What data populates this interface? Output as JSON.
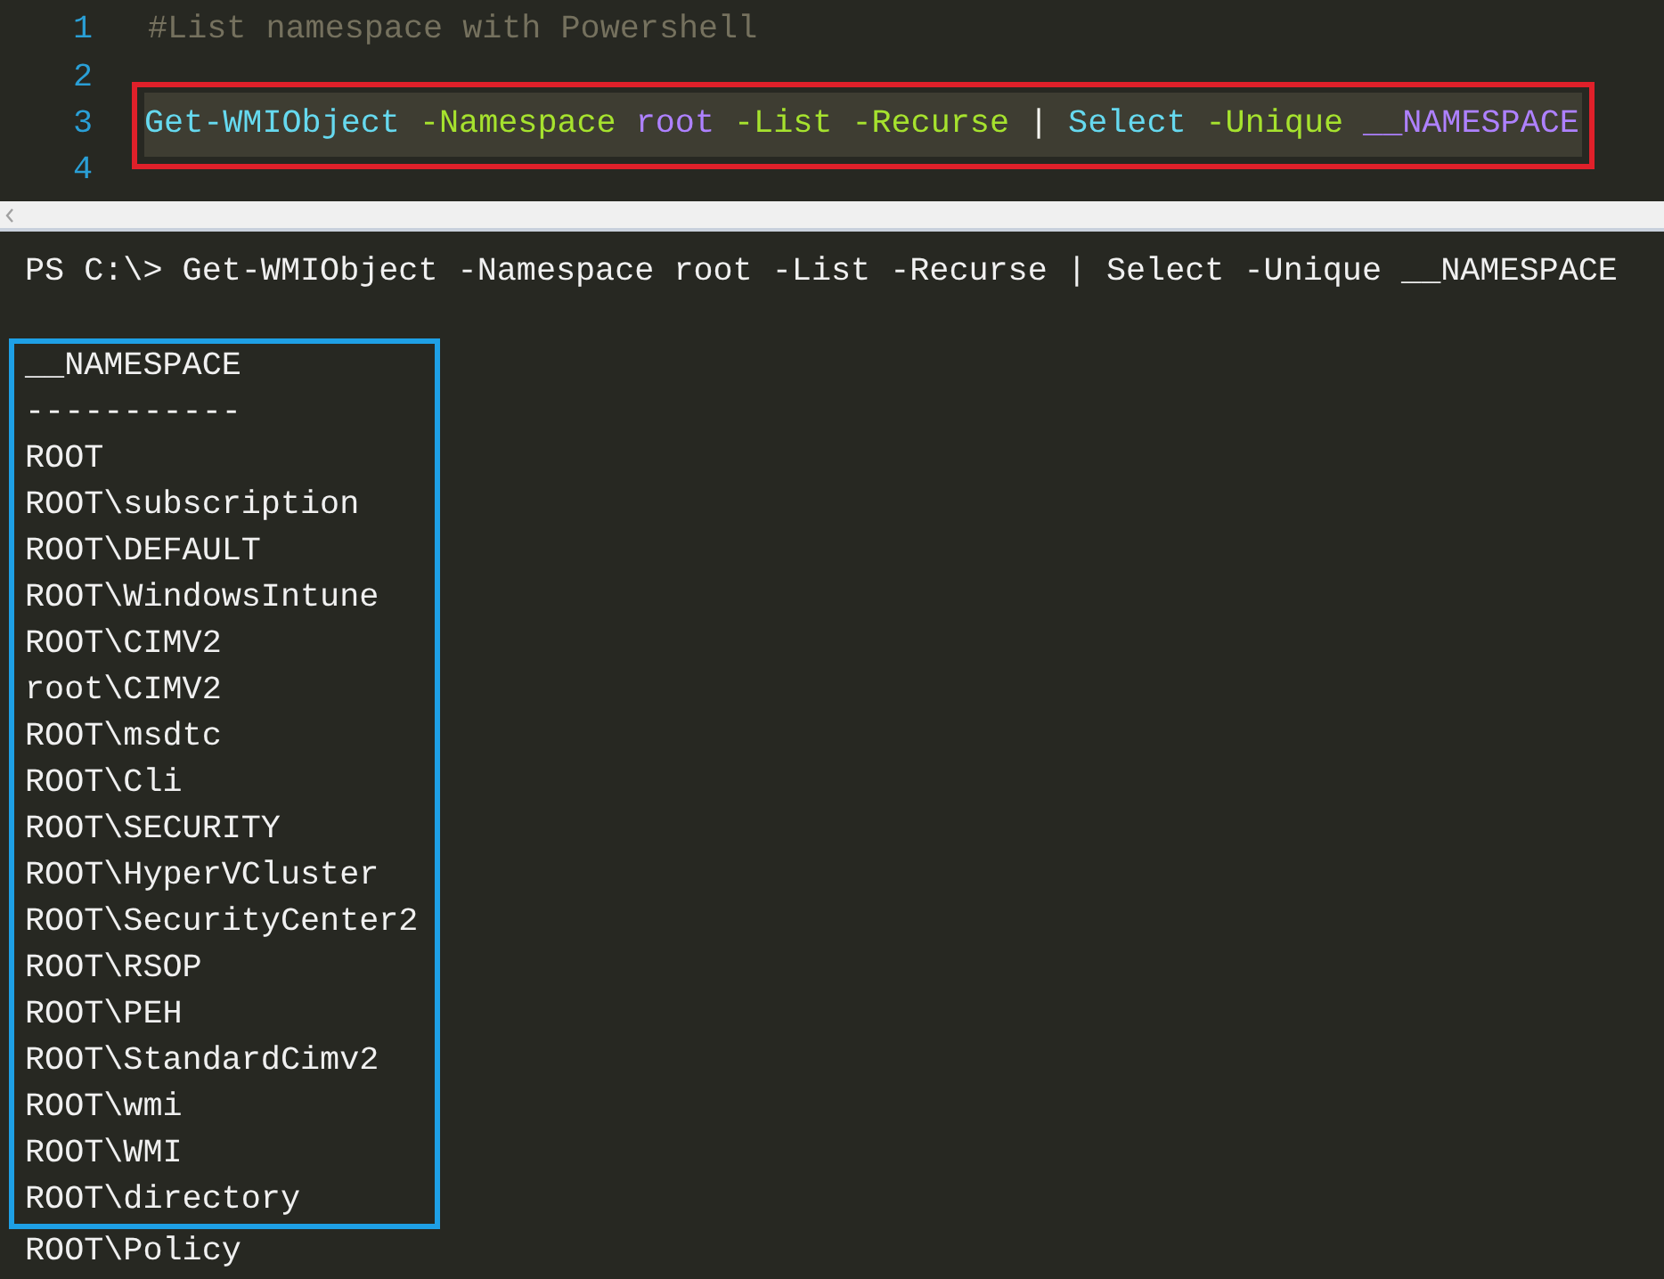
{
  "editor": {
    "lines": [
      {
        "number": "1",
        "kind": "plain",
        "tokens": [
          {
            "kind": "comment",
            "text": "#List namespace with Powershell"
          }
        ]
      },
      {
        "number": "2",
        "kind": "plain"
      },
      {
        "number": "3",
        "kind": "boxed",
        "tokens": [
          {
            "kind": "cmdlet",
            "text": "Get-WMIObject"
          },
          {
            "kind": "param",
            "text": "-Namespace"
          },
          {
            "kind": "value",
            "text": "root"
          },
          {
            "kind": "param",
            "text": "-List"
          },
          {
            "kind": "param",
            "text": "-Recurse"
          },
          {
            "kind": "pipe",
            "text": "|"
          },
          {
            "kind": "cmdlet",
            "text": "Select"
          },
          {
            "kind": "param",
            "text": "-Unique"
          },
          {
            "kind": "value",
            "text": "__NAMESPACE"
          }
        ]
      },
      {
        "number": "4",
        "kind": "plain"
      }
    ]
  },
  "console": {
    "prompt": "PS C:\\> Get-WMIObject -Namespace root -List -Recurse | Select -Unique __NAMESPACE",
    "boxed_output": [
      "__NAMESPACE",
      "-----------",
      "ROOT",
      "ROOT\\subscription",
      "ROOT\\DEFAULT",
      "ROOT\\WindowsIntune",
      "ROOT\\CIMV2",
      "root\\CIMV2",
      "ROOT\\msdtc",
      "ROOT\\Cli",
      "ROOT\\SECURITY",
      "ROOT\\HyperVCluster",
      "ROOT\\SecurityCenter2",
      "ROOT\\RSOP",
      "ROOT\\PEH",
      "ROOT\\StandardCimv2",
      "ROOT\\wmi",
      "ROOT\\WMI",
      "ROOT\\directory"
    ],
    "output_after": [
      "ROOT\\Policy"
    ]
  }
}
